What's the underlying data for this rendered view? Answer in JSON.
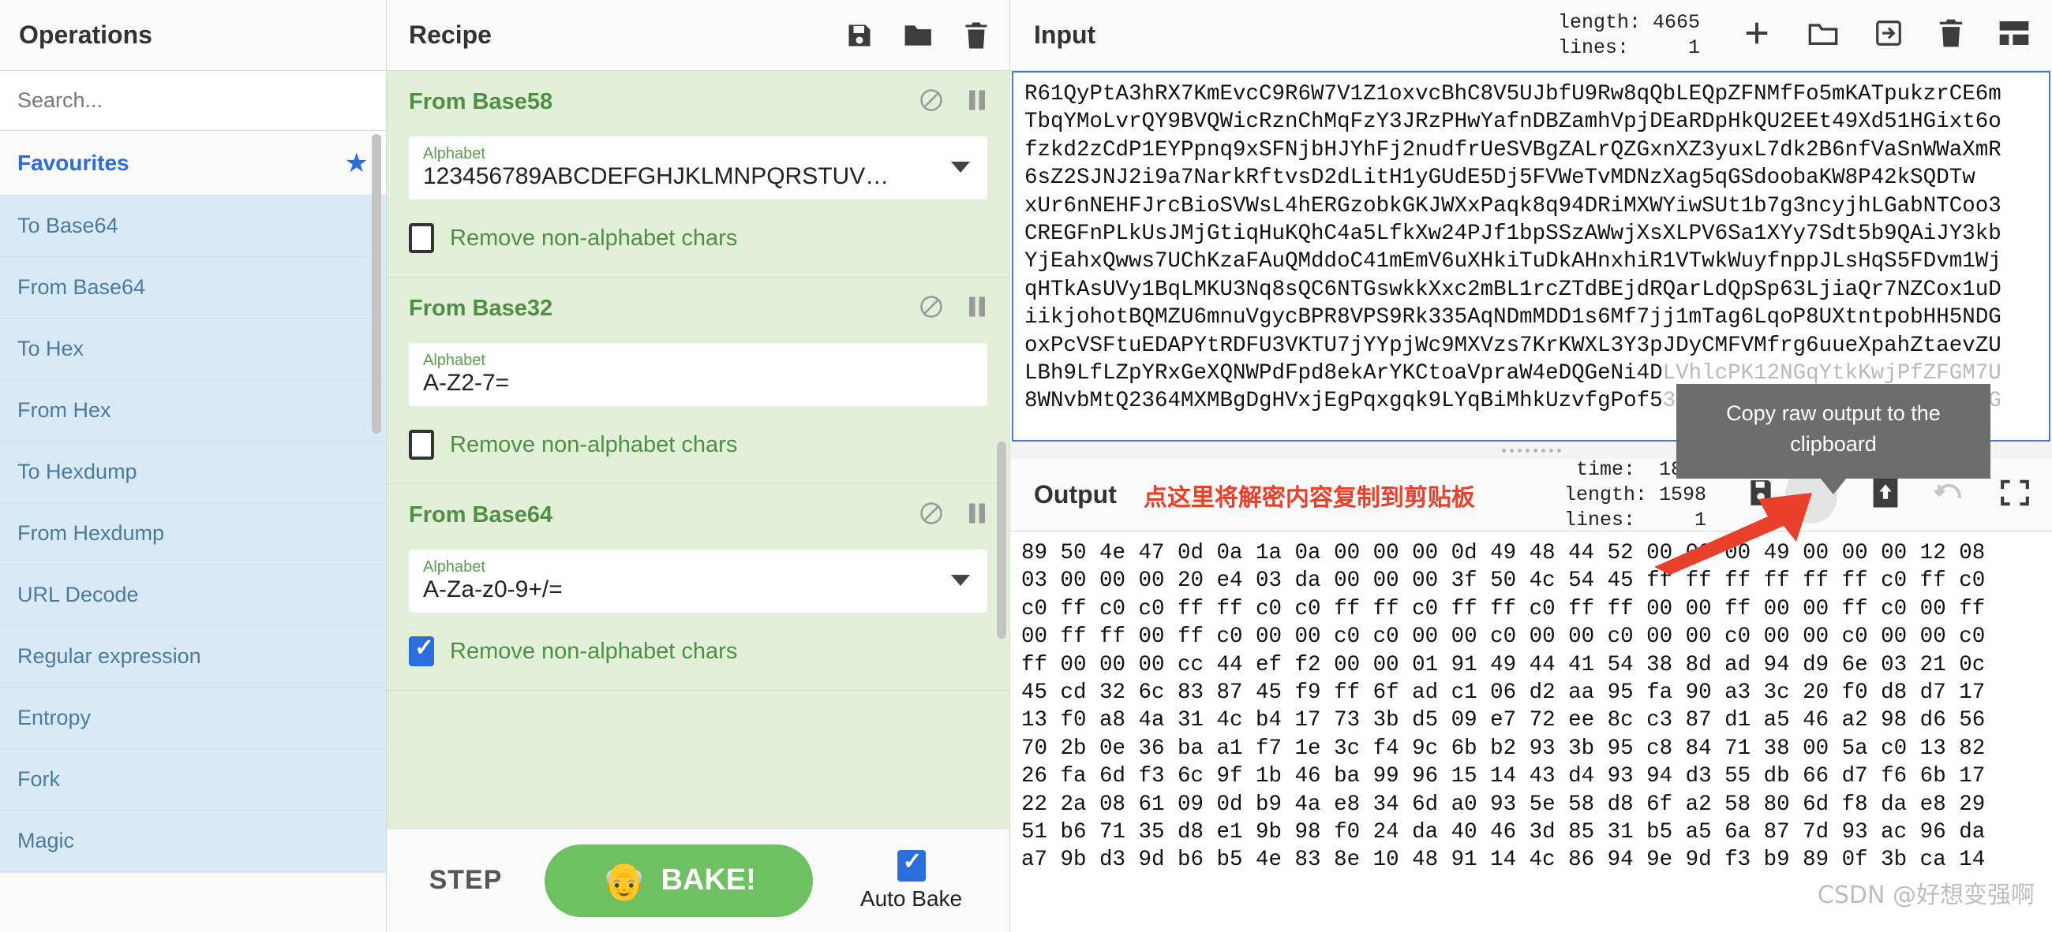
{
  "operations": {
    "title": "Operations",
    "search_placeholder": "Search...",
    "favourites_label": "Favourites",
    "star_icon": "star-icon",
    "items": [
      {
        "label": "To Base64"
      },
      {
        "label": "From Base64"
      },
      {
        "label": "To Hex"
      },
      {
        "label": "From Hex"
      },
      {
        "label": "To Hexdump"
      },
      {
        "label": "From Hexdump"
      },
      {
        "label": "URL Decode"
      },
      {
        "label": "Regular expression"
      },
      {
        "label": "Entropy"
      },
      {
        "label": "Fork"
      },
      {
        "label": "Magic"
      }
    ]
  },
  "recipe": {
    "title": "Recipe",
    "header_icons": [
      "save-icon",
      "folder-icon",
      "trash-icon"
    ],
    "operations": [
      {
        "name": "From Base58",
        "disable_icon": "disable-icon",
        "pause_icon": "pause-icon",
        "arg_label": "Alphabet",
        "arg_value": "123456789ABCDEFGHJKLMNPQRSTUV…",
        "has_dropdown": true,
        "checkbox_label": "Remove non-alphabet chars",
        "checkbox_checked": false
      },
      {
        "name": "From Base32",
        "disable_icon": "disable-icon",
        "pause_icon": "pause-icon",
        "arg_label": "Alphabet",
        "arg_value": "A-Z2-7=",
        "has_dropdown": false,
        "checkbox_label": "Remove non-alphabet chars",
        "checkbox_checked": false
      },
      {
        "name": "From Base64",
        "disable_icon": "disable-icon",
        "pause_icon": "pause-icon",
        "arg_label": "Alphabet",
        "arg_value": "A-Za-z0-9+/=",
        "has_dropdown": true,
        "checkbox_label": "Remove non-alphabet chars",
        "checkbox_checked": true
      }
    ],
    "footer": {
      "step_label": "STEP",
      "bake_label": "BAKE!",
      "bake_icon": "chef-icon",
      "auto_bake_label": "Auto Bake",
      "auto_bake_checked": true
    }
  },
  "input": {
    "title": "Input",
    "length_label": "length:",
    "length_value": "4665",
    "lines_label": "lines:",
    "lines_value": "1",
    "meta": "length: 4665\nlines:     1",
    "icons": [
      "add-tab-icon",
      "open-folder-icon",
      "import-icon",
      "trash-icon",
      "layout-icon"
    ],
    "text": "R61QyPtA3hRX7KmEvcC9R6W7V1Z1oxvcBhC8V5UJbfU9Rw8qQbLEQpZFNMfFo5mKATpukzrCE6m\nTbqYMoLvrQY9BVQWicRznChMqFzY3JRzPHwYafnDBZamhVpjDEaRDpHkQU2EEt49Xd51HGixt6o\nfzkd2zCdP1EYPpnq9xSFNjbHJYhFj2nudfrUeSVBgZALrQZGxnXZ3yuxL7dk2B6nfVaSnWWaXmR\n6sZ2SJNJ2i9a7NarkRftvsD2dLitH1yGUdE5Dj5FVWeTvMDNzXag5qGSdoobaKW8P42kSQDTw\nxUr6nNEHFJrcBioSVWsL4hERGzobkGKJWXxPaqk8q94DRiMXWYiwSUt1b7g3ncyjhLGabNTCoo3\nCREGFnPLkUsJMjGtiqHuKQhC4a5LfkXw24PJf1bpSSzAWwjXsXLPV6Sa1XYy7Sdt5b9QAiJY3kb\nYjEahxQwws7UChKzaFAuQMddoC41mEmV6uXHkiTuDkAHnxhiR1VTwkWuyfnppJLsHqS5FDvm1Wj\nqHTkAsUVy1BqLMKU3Nq8sQC6NTGswkkXxc2mBL1rcZTdBEjdRQarLdQpSp63LjiaQr7NZCox1uD\niikjohotBQMZU6mnuVgycBPR8VPS9Rk335AqNDmMDD1s6Mf7jj1mTag6LqoP8UXtntpobHH5NDG\noxPcVSFtuEDAPYtRDFU3VKTU7jYYpjWc9MXVzs7KrKWXL3Y3pJDyCMFVMfrg6uueXpahZtaevZU",
    "text_tail_line1": "LBh9LfLZpYRxGeXQNWPdFpd8ekArYKCtoaVpraW4eDQGeNi4D",
    "text_tail_line1_faded": "LVhlcPK12NGqYtkKwjPfZFGM7U",
    "text_tail_line2": "8WNvbMtQ2364MXMBgDgHVxjEgPqxgqk9LYqBiMhkUzvfgPof5",
    "text_tail_line2_faded": "3aHPePAq0ugTS3uZ2VuRQ9fRRG"
  },
  "tooltip": {
    "text": "Copy raw output to the clipboard"
  },
  "output": {
    "title": "Output",
    "annotation": "点这里将解密内容复制到剪贴板",
    "time_label": "time:",
    "time_value": "18ms",
    "length_label": "length:",
    "length_value": "1598",
    "lines_label": "lines:",
    "lines_value": "1",
    "meta": "time:  18ms\nlength: 1598\nlines:     1",
    "icons": [
      "save-icon",
      "copy-icon",
      "open-in-tab-icon",
      "undo-icon",
      "maximize-icon"
    ],
    "text": "89 50 4e 47 0d 0a 1a 0a 00 00 00 0d 49 48 44 52 00 00 00 49 00 00 00 12 08\n03 00 00 00 20 e4 03 da 00 00 00 3f 50 4c 54 45 ff ff ff ff ff ff c0 ff c0\nc0 ff c0 c0 ff ff c0 c0 ff ff c0 ff ff c0 ff ff 00 00 ff 00 00 ff c0 00 ff\n00 ff ff 00 ff c0 00 00 c0 c0 00 00 c0 00 00 c0 00 00 c0 00 00 c0 00 00 c0\nff 00 00 00 cc 44 ef f2 00 00 01 91 49 44 41 54 38 8d ad 94 d9 6e 03 21 0c\n45 cd 32 6c 83 87 45 f9 ff 6f ad c1 06 d2 aa 95 fa 90 a3 3c 20 f0 d8 d7 17\n13 f0 a8 4a 31 4c b4 17 73 3b d5 09 e7 72 ee 8c c3 87 d1 a5 46 a2 98 d6 56\n70 2b 0e 36 ba a1 f7 1e 3c f4 9c 6b b2 93 3b 95 c8 84 71 38 00 5a c0 13 82\n26 fa 6d f3 6c 9f 1b 46 ba 99 96 15 14 43 d4 93 94 d3 55 db 66 d7 f6 6b 17\n22 2a 08 61 09 0d b9 4a e8 34 6d a0 93 5e 58 d8 6f a2 58 80 6d f8 da e8 29\n51 b6 71 35 d8 e1 9b 98 f0 24 da 40 46 3d 85 31 b5 a5 6a 87 7d 93 ac 96 da\na7 9b d3 9d b6 b5 4e 83 8e 10 48 91 14 4c 86 94 9e 9d f3 b9 89 0f 3b ca 14"
  },
  "watermark": "CSDN @好想变强啊",
  "colors": {
    "accent_blue": "#2a6ddb",
    "recipe_green": "#e2efd9",
    "op_green": "#4f8f44",
    "bake_green": "#6fbf63",
    "sidebar_item": "#d9eaf6",
    "annotation_red": "#e8402a"
  }
}
